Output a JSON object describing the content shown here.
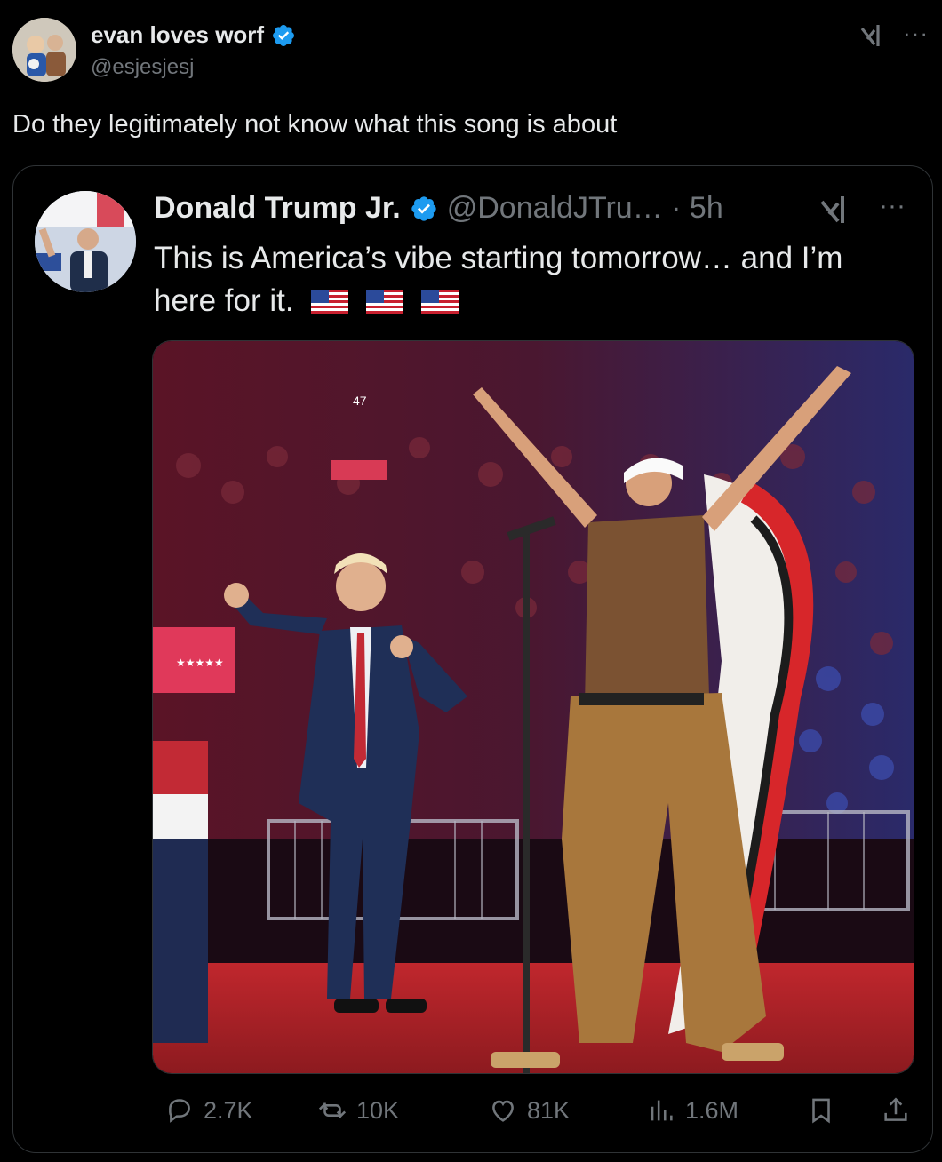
{
  "tweet": {
    "display_name": "evan loves worf",
    "handle": "@esjesjesj",
    "text": "Do they legitimately not know what this song is about"
  },
  "quoted": {
    "display_name": "Donald Trump Jr.",
    "handle_time": "@DonaldJTru… · 5h",
    "text": "This is America’s vibe starting tomorrow… and I’m here for it.",
    "media": {
      "stage_sign_number": "47",
      "stars_label": "★★★★★"
    },
    "actions": {
      "replies": "2.7K",
      "reposts": "10K",
      "likes": "81K",
      "views": "1.6M"
    }
  },
  "colors": {
    "verified": "#1d9bf0",
    "muted_text": "#71767b",
    "primary_text": "#e7e9ea",
    "border": "#2f3336"
  },
  "icons": [
    "verified-badge-icon",
    "grok-icon",
    "more-icon",
    "us-flag-icon",
    "reply-icon",
    "repost-icon",
    "like-icon",
    "views-icon",
    "bookmark-icon",
    "share-icon"
  ]
}
